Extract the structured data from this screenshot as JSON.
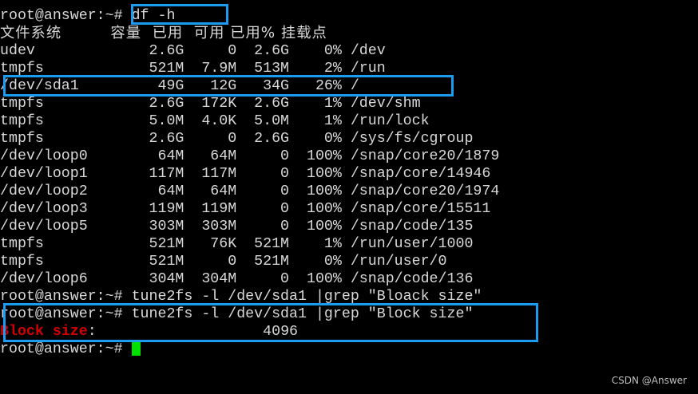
{
  "terminal": {
    "prompt": "root@answer:~# ",
    "command1": "df -h",
    "header_line": "文件系统         容量  已用  可用 已用% 挂载点",
    "rows": [
      "udev             2.6G     0  2.6G    0% /dev",
      "tmpfs            521M  7.9M  513M    2% /run",
      "/dev/sda1         49G   12G   34G   26% /",
      "tmpfs            2.6G  172K  2.6G    1% /dev/shm",
      "tmpfs            5.0M  4.0K  5.0M    1% /run/lock",
      "tmpfs            2.6G     0  2.6G    0% /sys/fs/cgroup",
      "/dev/loop0        64M   64M     0  100% /snap/core20/1879",
      "/dev/loop1       117M  117M     0  100% /snap/core/14946",
      "/dev/loop2        64M   64M     0  100% /snap/core20/1974",
      "/dev/loop3       119M  119M     0  100% /snap/core/15511",
      "/dev/loop5       303M  303M     0  100% /snap/code/135",
      "tmpfs            521M   76K  521M    1% /run/user/1000",
      "tmpfs            521M     0  521M    0% /run/user/0",
      "/dev/loop6       304M  304M     0  100% /snap/code/136"
    ],
    "command2": "tune2fs -l /dev/sda1 |grep \"Bloack size\"",
    "command3": "tune2fs -l /dev/sda1 |grep \"Block size\"",
    "result_label": "Block size",
    "result_value": ":                   4096"
  },
  "watermark": "CSDN @Answer",
  "colors": {
    "highlight": "#1b9cf0",
    "match": "#d40000",
    "cursor": "#00e000"
  }
}
